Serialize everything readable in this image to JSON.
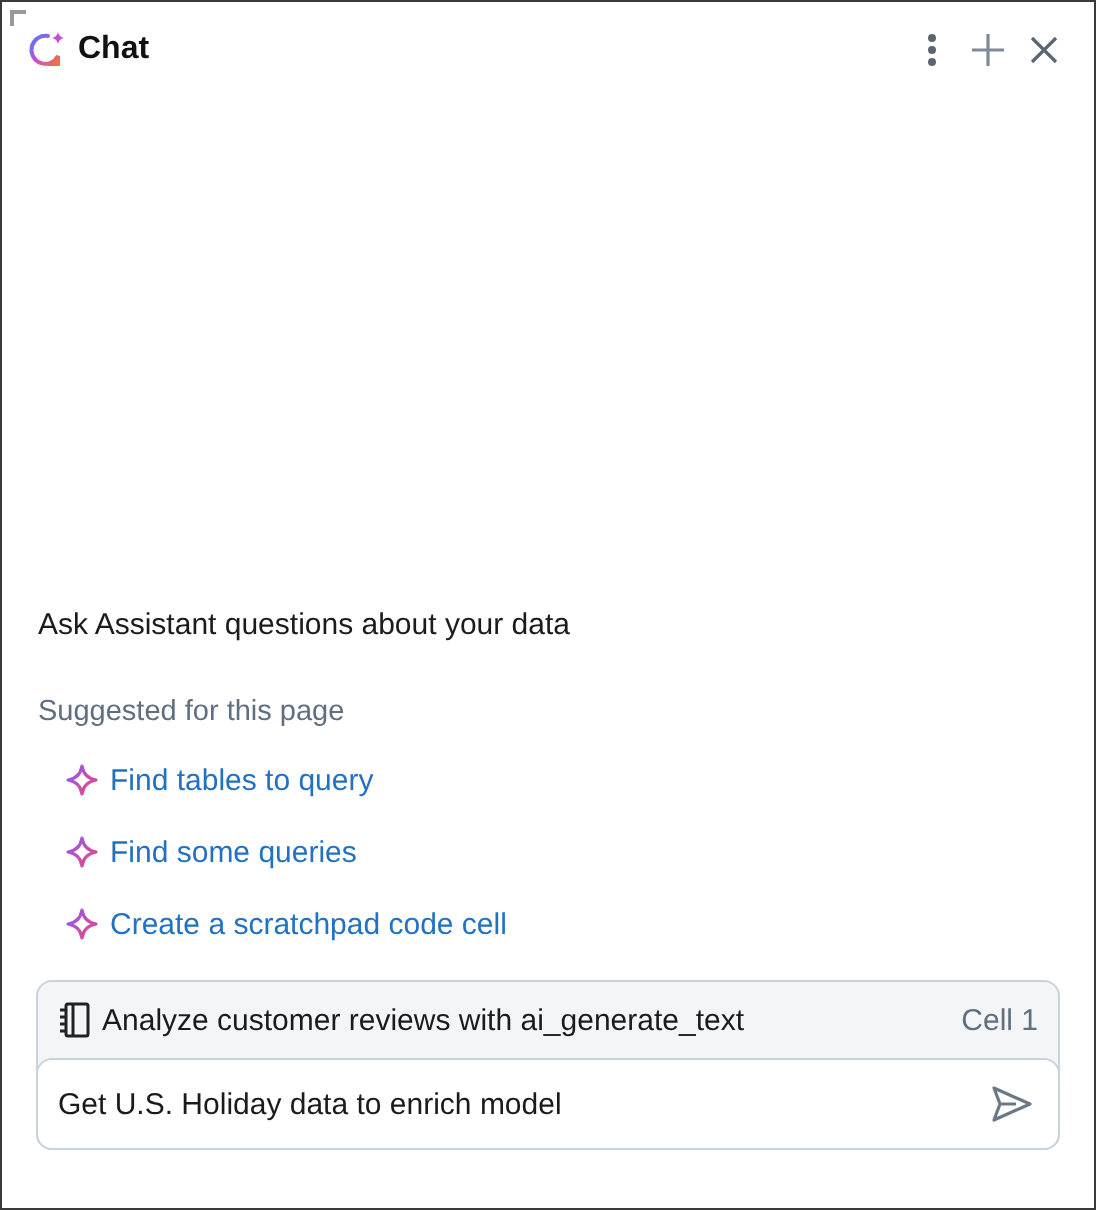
{
  "header": {
    "title": "Chat"
  },
  "intro": "Ask Assistant questions about your data",
  "suggestions": {
    "heading": "Suggested for this page",
    "items": [
      {
        "label": "Find tables to query"
      },
      {
        "label": "Find some queries"
      },
      {
        "label": "Create a scratchpad code cell"
      }
    ]
  },
  "context": {
    "label": "Analyze customer reviews with ai_generate_text",
    "cell": "Cell 1"
  },
  "input": {
    "value": "Get U.S. Holiday data to enrich model"
  }
}
